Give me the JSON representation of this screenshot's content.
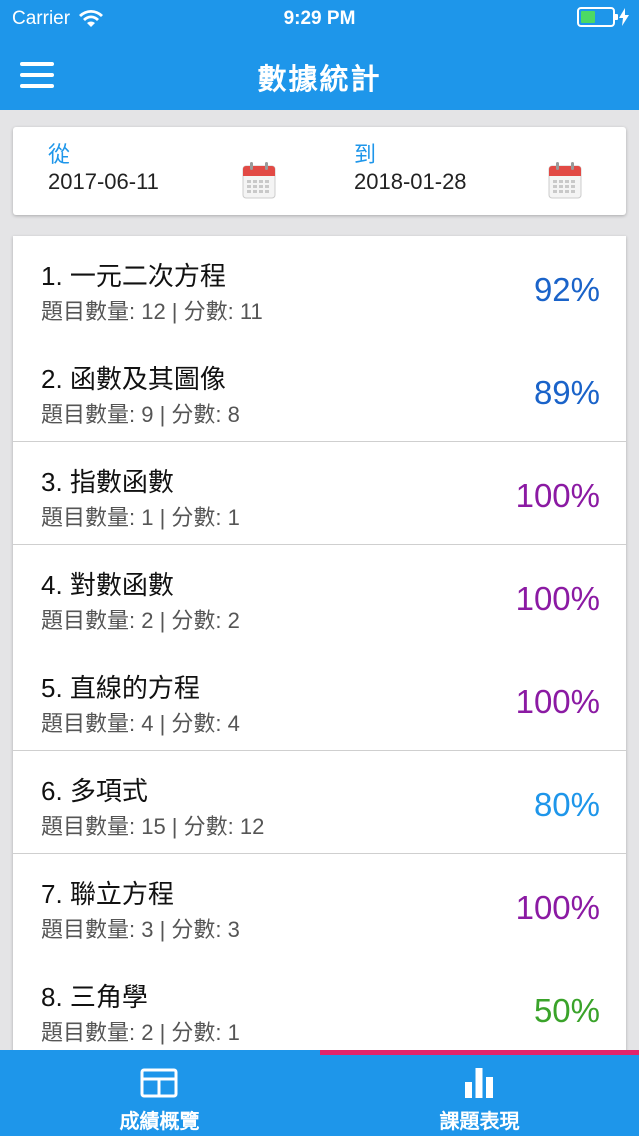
{
  "status_bar": {
    "carrier": "Carrier",
    "time": "9:29 PM"
  },
  "nav": {
    "title": "數據統計"
  },
  "date_range": {
    "from_label": "從",
    "from_value": "2017-06-11",
    "to_label": "到",
    "to_value": "2018-01-28"
  },
  "topics": [
    {
      "title": "1. 一元二次方程",
      "sub": "題目數量: 12 | 分數: 11",
      "score": "92%",
      "color": "#1a63c9"
    },
    {
      "title": "2. 函數及其圖像",
      "sub": "題目數量: 9 | 分數: 8",
      "score": "89%",
      "color": "#1a63c9"
    },
    {
      "title": "3. 指數函數",
      "sub": "題目數量: 1 | 分數: 1",
      "score": "100%",
      "color": "#8b1aa3"
    },
    {
      "title": "4. 對數函數",
      "sub": "題目數量: 2 | 分數: 2",
      "score": "100%",
      "color": "#8b1aa3"
    },
    {
      "title": "5. 直線的方程",
      "sub": "題目數量: 4 | 分數: 4",
      "score": "100%",
      "color": "#8b1aa3"
    },
    {
      "title": "6. 多項式",
      "sub": "題目數量: 15 | 分數: 12",
      "score": "80%",
      "color": "#1e96ea"
    },
    {
      "title": "7. 聯立方程",
      "sub": "題目數量: 3 | 分數: 3",
      "score": "100%",
      "color": "#8b1aa3"
    },
    {
      "title": "8. 三角學",
      "sub": "題目數量: 2 | 分數: 1",
      "score": "50%",
      "color": "#3aa32a"
    }
  ],
  "tabs": [
    {
      "label": "成績概覽",
      "icon": "layout-icon",
      "selected": false
    },
    {
      "label": "課題表現",
      "icon": "bar-chart-icon",
      "selected": true
    }
  ],
  "colors": {
    "primary": "#1e96ea",
    "tab_indicator": "#e3246b",
    "battery": "#4cd964",
    "calendar_red": "#e24a45"
  }
}
